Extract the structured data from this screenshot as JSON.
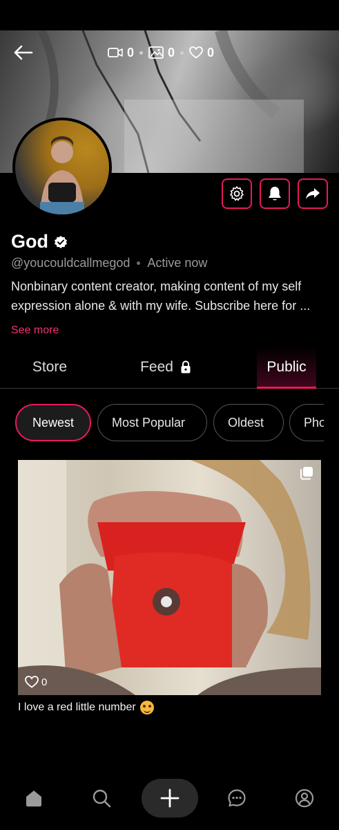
{
  "stats": {
    "videos": "0",
    "photos": "0",
    "likes": "0"
  },
  "profile": {
    "name": "God",
    "handle": "@youcouldcallmegod",
    "status": "Active now",
    "bio": "Nonbinary content creator, making content of my self expression alone & with my wife. Subscribe here for ...",
    "see_more": "See more"
  },
  "tabs": [
    {
      "label": "Store",
      "active": false
    },
    {
      "label": "Feed",
      "active": false,
      "locked": true
    },
    {
      "label": "Public",
      "active": true
    }
  ],
  "filters": [
    {
      "label": "Newest",
      "active": true
    },
    {
      "label": "Most Popular",
      "active": false
    },
    {
      "label": "Oldest",
      "active": false
    },
    {
      "label": "Photos",
      "active": false
    }
  ],
  "post": {
    "likes": "0",
    "caption": "I love a red little number",
    "emoji": "smiling-face-with-hearts"
  },
  "icons": {
    "back": "arrow-left-icon",
    "video": "video-icon",
    "photo": "image-icon",
    "like": "heart-icon",
    "settings": "gear-icon",
    "notify": "bell-icon",
    "share": "share-icon",
    "verified": "verified-badge-icon",
    "lock": "lock-icon",
    "multi": "multiple-images-icon",
    "nav": [
      "home-icon",
      "search-icon",
      "plus-icon",
      "chat-icon",
      "profile-icon"
    ]
  },
  "colors": {
    "accent": "#e8195e",
    "background": "#000000",
    "muted": "#9a9a9a"
  }
}
